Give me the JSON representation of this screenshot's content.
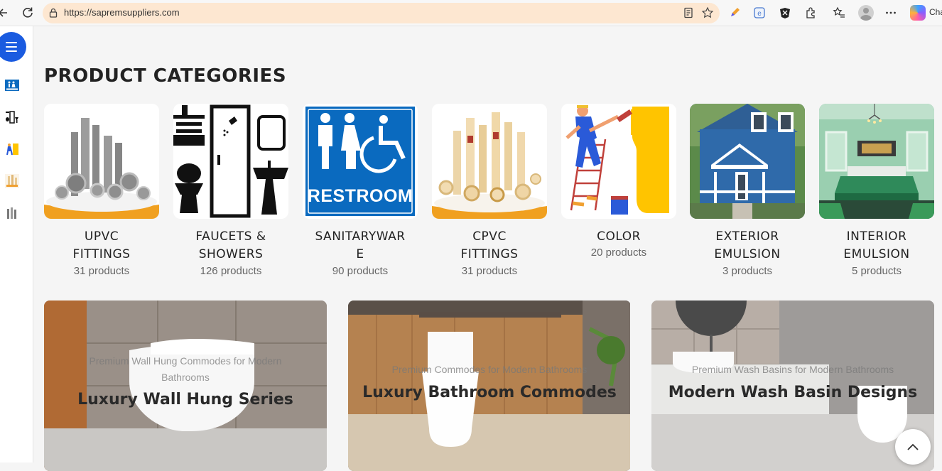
{
  "browser": {
    "url": "https://sapremsuppliers.com",
    "copilot_label": "Cha"
  },
  "main": {
    "section_title": "PRODUCT CATEGORIES",
    "categories": [
      {
        "line1": "UPVC",
        "line2": "FITTINGS",
        "count": "31 products"
      },
      {
        "line1": "FAUCETS &",
        "line2": "SHOWERS",
        "count": "126 products"
      },
      {
        "line1": "SANITARYWAR",
        "line2": "E",
        "count": "90 products"
      },
      {
        "line1": "CPVC",
        "line2": "FITTINGS",
        "count": "31 products"
      },
      {
        "line1": "COLOR",
        "line2": "",
        "count": "20 products"
      },
      {
        "line1": "EXTERIOR",
        "line2": "EMULSION",
        "count": "3 products"
      },
      {
        "line1": "INTERIOR",
        "line2": "EMULSION",
        "count": "5 products"
      }
    ],
    "restroom_sign_text": "RESTROOM",
    "banners": [
      {
        "subtitle": "Premium Wall Hung Commodes for Modern Bathrooms",
        "title": "Luxury Wall Hung Series"
      },
      {
        "subtitle": "Premium Commodes for Modern Bathrooms",
        "title": "Luxury Bathroom Commodes"
      },
      {
        "subtitle": "Premium Wash Basins for Modern Bathrooms",
        "title": "Modern Wash Basin Designs"
      }
    ]
  },
  "colors": {
    "accent": "#1a5be0",
    "restroom_blue": "#0a6abf",
    "color_yellow": "#ffc400"
  }
}
